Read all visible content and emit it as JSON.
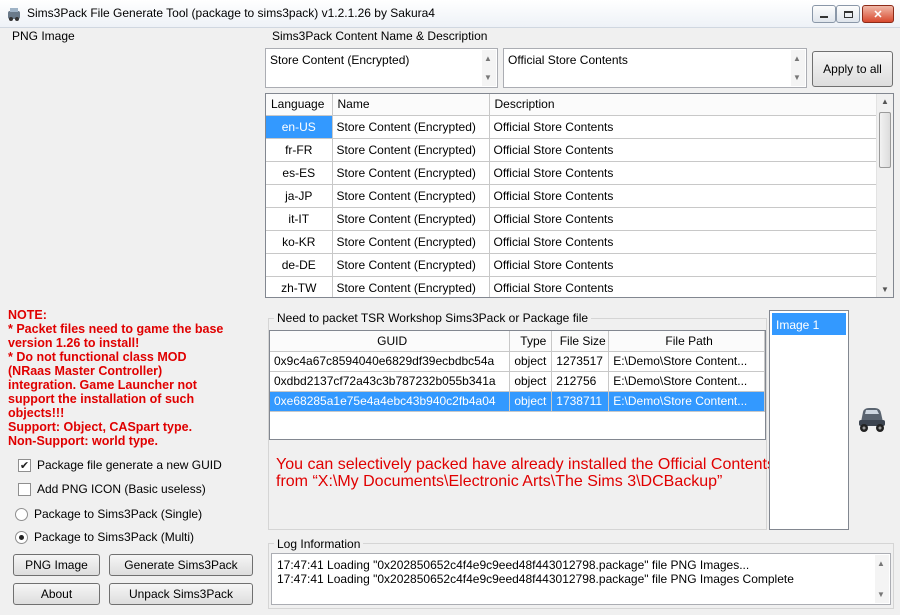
{
  "window": {
    "title": "Sims3Pack File Generate Tool (package to sims3pack) v1.2.1.26 by Sakura4",
    "minimize": "▭",
    "maximize": "▢",
    "close": "✕"
  },
  "png_panel": {
    "label": "PNG Image"
  },
  "content": {
    "group_label": "Sims3Pack Content Name & Description",
    "name_value": "Store Content (Encrypted)",
    "description_value": "Official Store Contents",
    "apply_button": "Apply to all",
    "columns": [
      "Language",
      "Name",
      "Description"
    ],
    "rows": [
      {
        "language": "en-US",
        "name": "Store Content (Encrypted)",
        "description": "Official Store Contents"
      },
      {
        "language": "fr-FR",
        "name": "Store Content (Encrypted)",
        "description": "Official Store Contents"
      },
      {
        "language": "es-ES",
        "name": "Store Content (Encrypted)",
        "description": "Official Store Contents"
      },
      {
        "language": "ja-JP",
        "name": "Store Content (Encrypted)",
        "description": "Official Store Contents"
      },
      {
        "language": "it-IT",
        "name": "Store Content (Encrypted)",
        "description": "Official Store Contents"
      },
      {
        "language": "ko-KR",
        "name": "Store Content (Encrypted)",
        "description": "Official Store Contents"
      },
      {
        "language": "de-DE",
        "name": "Store Content (Encrypted)",
        "description": "Official Store Contents"
      },
      {
        "language": "zh-TW",
        "name": "Store Content (Encrypted)",
        "description": "Official Store Contents"
      }
    ]
  },
  "note": {
    "lines": [
      "NOTE:",
      "* Packet files need to game the base",
      "version 1.26 to install!",
      "* Do not functional class MOD",
      "(NRaas Master Controller)",
      "integration. Game Launcher not",
      "support the installation of such",
      "objects!!!",
      "Support: Object, CASpart type.",
      "Non-Support: world type."
    ]
  },
  "options": {
    "new_guid": "Package file generate a new GUID",
    "add_png_icon": "Add PNG ICON (Basic useless)",
    "single": "Package to Sims3Pack (Single)",
    "multi": "Package to Sims3Pack (Multi)"
  },
  "buttons": {
    "png_image": "PNG Image",
    "generate": "Generate Sims3Pack",
    "about": "About",
    "unpack": "Unpack Sims3Pack"
  },
  "files": {
    "group_label": "Need to packet TSR Workshop Sims3Pack or Package file",
    "columns": [
      "GUID",
      "Type",
      "File Size",
      "File Path"
    ],
    "rows": [
      {
        "guid": "0x9c4a67c8594040e6829df39ecbdbc54a",
        "type": "object",
        "size": "1273517",
        "path": "E:\\Demo\\Store Content..."
      },
      {
        "guid": "0xdbd2137cf72a43c3b787232b055b341a",
        "type": "object",
        "size": "212756",
        "path": "E:\\Demo\\Store Content..."
      },
      {
        "guid": "0xe68285a1e75e4a4ebc43b940c2fb4a04",
        "type": "object",
        "size": "1738711",
        "path": "E:\\Demo\\Store Content..."
      }
    ]
  },
  "image_list": {
    "items": [
      "Image 1"
    ]
  },
  "message": {
    "line1": "You can selectively packed have already installed the Official Contents",
    "line2": "from “X:\\My Documents\\Electronic Arts\\The Sims 3\\DCBackup”"
  },
  "log": {
    "group_label": "Log Information",
    "lines": [
      "17:47:41 Loading \"0x202850652c4f4e9c9eed48f443012798.package\" file PNG Images...",
      "17:47:41 Loading \"0x202850652c4f4e9c9eed48f443012798.package\" file PNG Images Complete"
    ]
  }
}
